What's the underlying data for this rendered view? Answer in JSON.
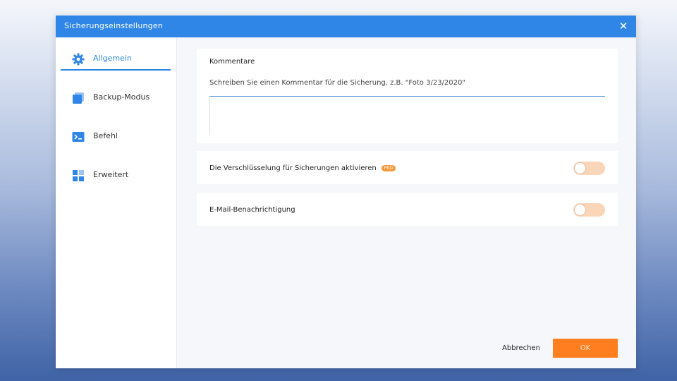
{
  "dialog": {
    "title": "Sicherungseinstellungen",
    "close_glyph": "✕",
    "accent": "#2f86e6"
  },
  "sidebar": {
    "items": [
      {
        "label": "Allgemein",
        "icon": "gear-icon",
        "active": true
      },
      {
        "label": "Backup-Modus",
        "icon": "backup-mode-icon",
        "active": false
      },
      {
        "label": "Befehl",
        "icon": "terminal-icon",
        "active": false
      },
      {
        "label": "Erweitert",
        "icon": "grid-icon",
        "active": false
      }
    ]
  },
  "comment": {
    "heading": "Kommentare",
    "hint": "Schreiben Sie einen Kommentar für die Sicherung, z.B. \"Foto 3/23/2020\"",
    "value": ""
  },
  "encryption": {
    "label": "Die Verschlüsselung für Sicherungen aktivieren",
    "badge": "PRO",
    "enabled": false
  },
  "email": {
    "label": "E-Mail-Benachrichtigung",
    "enabled": false
  },
  "toggle_color": "#fbd5b8",
  "footer": {
    "cancel_label": "Abbrechen",
    "ok_label": "OK",
    "ok_color": "#ff7e1f"
  }
}
